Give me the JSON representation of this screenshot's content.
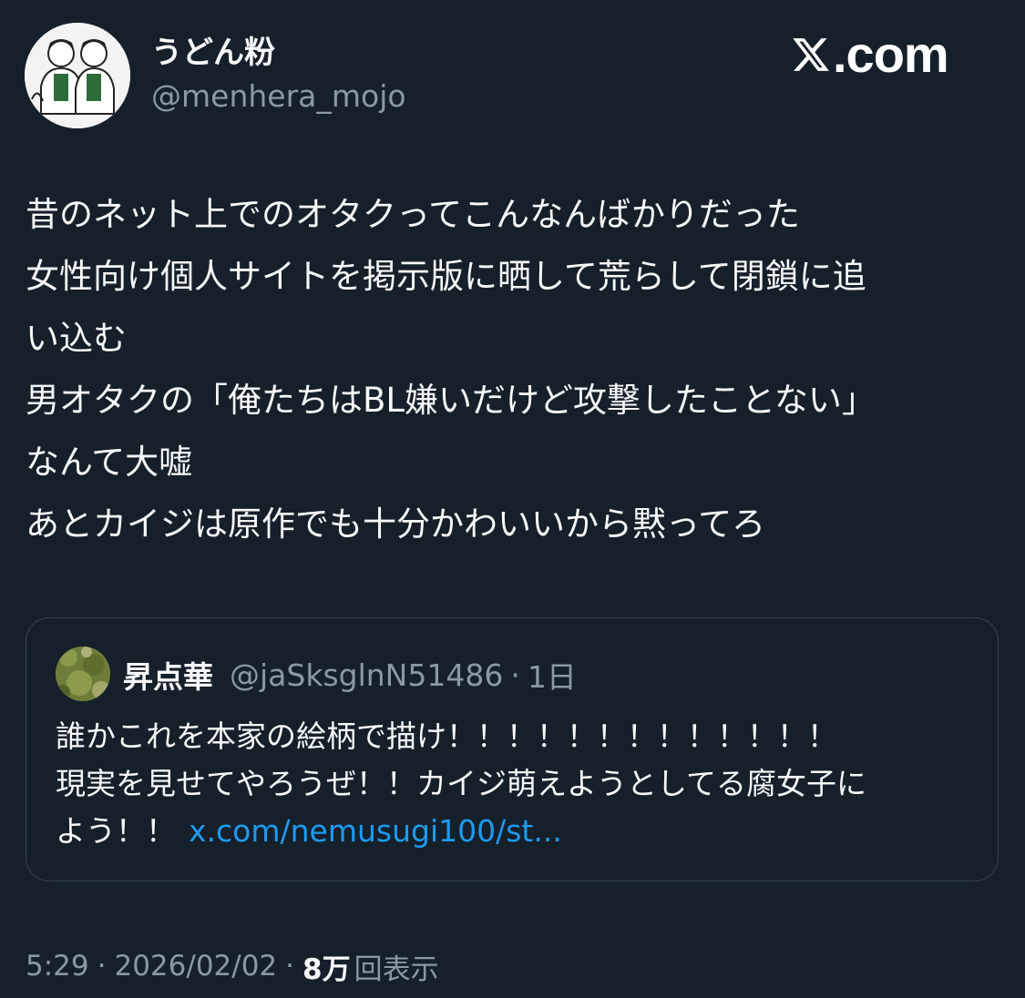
{
  "author": {
    "display_name": "うどん粉",
    "handle": "@menhera_mojo",
    "avatar_icon": "avatar-illustration-icon"
  },
  "brand": {
    "logo_icon": "x-logo-icon",
    "text": ".com"
  },
  "tweet": {
    "lines": [
      "昔のネット上でのオタクってこんなんばかりだった",
      "女性向け個人サイトを掲示版に晒して荒らして閉鎖に追",
      "い込む",
      "男オタクの「俺たちはBL嫌いだけど攻撃したことない」",
      "なんて大嘘",
      "あとカイジは原作でも十分かわいいから黙ってろ"
    ]
  },
  "quote": {
    "display_name": "昇点華",
    "handle": "@jaSksglnN51486",
    "separator": "·",
    "time": "1日",
    "avatar_icon": "grass-photo-avatar-icon",
    "lines": [
      "誰かこれを本家の絵柄で描け！！！！！！！！！！！！！",
      "現実を見せてやろうぜ！！カイジ萌えようとしてる腐女子に",
      "よう！！"
    ],
    "link": "x.com/nemusugi100/st..."
  },
  "meta": {
    "time": "5:29",
    "separator": "·",
    "date": "2026/02/02",
    "views_count": "8万",
    "views_label": "回表示"
  },
  "colors": {
    "background": "#15202b",
    "text_primary": "#f7f9f9",
    "text_secondary": "#8b98a5",
    "link": "#1d9bf0",
    "border": "#38444d"
  }
}
